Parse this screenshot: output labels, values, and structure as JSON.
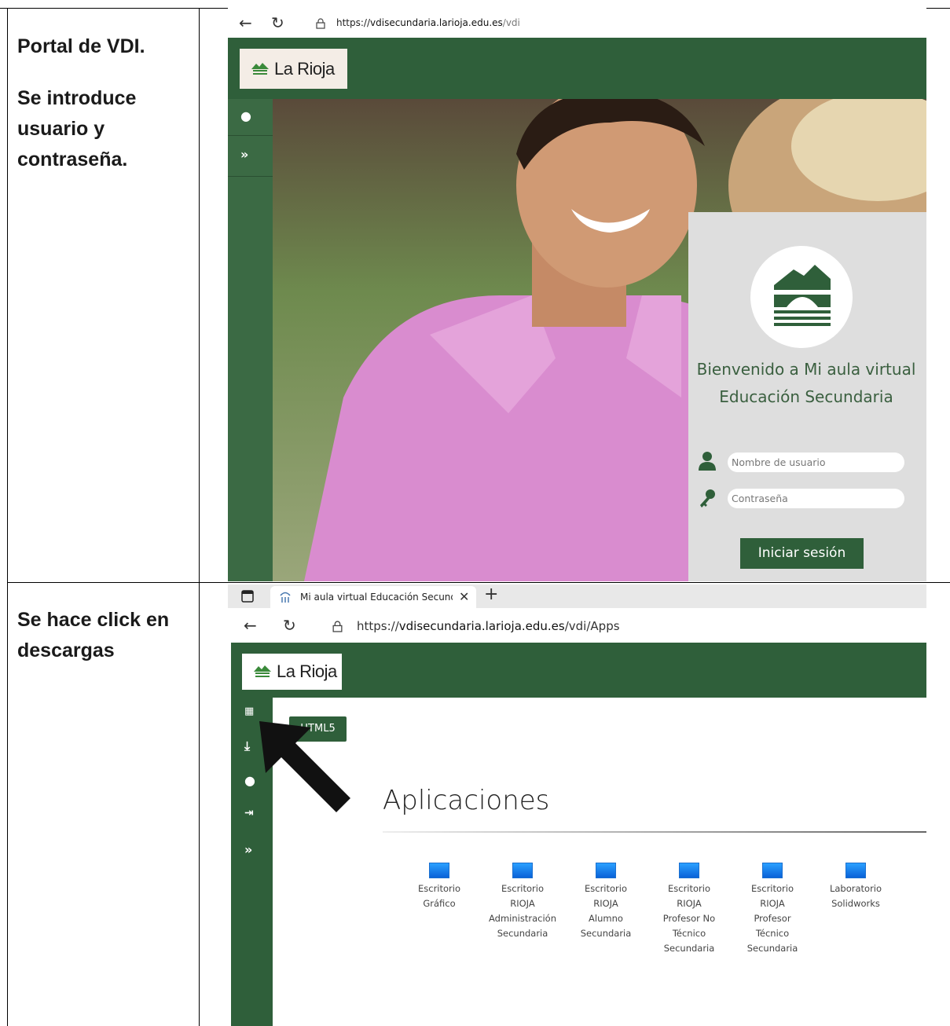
{
  "rows": [
    {
      "left_text": [
        "Portal de VDI.",
        "Se introduce",
        "usuario y",
        "contraseña."
      ],
      "screenshot": {
        "url_prefix": "https://",
        "url_host": "vdisecundaria.larioja.edu.es",
        "url_path": "/vdi",
        "logo_text": "La Rioja",
        "login": {
          "welcome": "Bienvenido a Mi aula virtual Educación Secundaria",
          "username_placeholder": "Nombre de usuario",
          "password_placeholder": "Contraseña",
          "login_button": "Iniciar sesión"
        }
      }
    },
    {
      "left_text": [
        "Se hace click en",
        "descargas"
      ],
      "screenshot": {
        "tab_title": "Mi aula virtual Educación Secund",
        "url_prefix": "https://",
        "url_host": "vdisecundaria.larioja.edu.es",
        "url_path": "/vdi/Apps",
        "logo_text": "La Rioja",
        "html5_button": "HTML5",
        "apps_title": "Aplicaciones",
        "apps": [
          [
            "Escritorio",
            "Gráfico"
          ],
          [
            "Escritorio",
            "RIOJA",
            "Administración",
            "Secundaria"
          ],
          [
            "Escritorio",
            "RIOJA",
            "Alumno",
            "Secundaria"
          ],
          [
            "Escritorio",
            "RIOJA",
            "Profesor No",
            "Técnico",
            "Secundaria"
          ],
          [
            "Escritorio",
            "RIOJA",
            "Profesor",
            "Técnico",
            "Secundaria"
          ],
          [
            "Laboratorio",
            "Solidworks"
          ]
        ]
      }
    }
  ],
  "colors": {
    "brand_green": "#2f5f3a",
    "login_panel": "#dedede",
    "app_icon_blue": "#1e88ee"
  }
}
